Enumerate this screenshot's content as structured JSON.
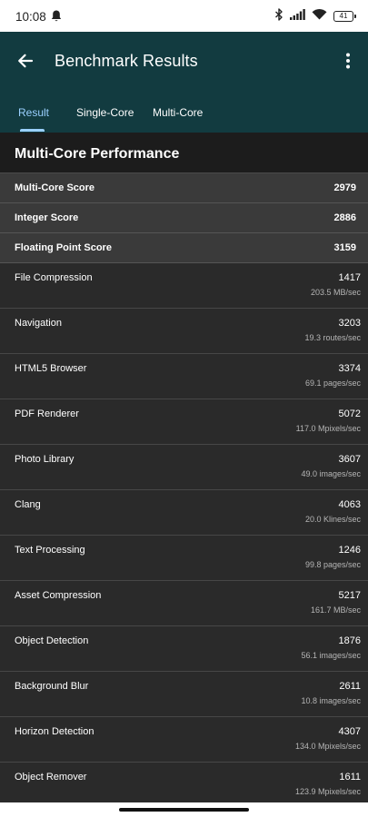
{
  "status_bar": {
    "time": "10:08",
    "battery": "41",
    "icons": [
      "notification-bell-icon",
      "bluetooth-icon",
      "signal-icon",
      "wifi-icon",
      "battery-icon"
    ]
  },
  "header": {
    "title": "Benchmark Results",
    "background": "#123b40",
    "accent": "#9ad0ff"
  },
  "tabs": [
    {
      "label": "Result",
      "active": true
    },
    {
      "label": "Single-Core",
      "active": false
    },
    {
      "label": "Multi-Core",
      "active": false
    }
  ],
  "section": {
    "title": "Multi-Core Performance"
  },
  "summary_scores": [
    {
      "label": "Multi-Core Score",
      "value": "2979"
    },
    {
      "label": "Integer Score",
      "value": "2886"
    },
    {
      "label": "Floating Point Score",
      "value": "3159"
    }
  ],
  "workloads": [
    {
      "name": "File Compression",
      "score": "1417",
      "rate": "203.5 MB/sec"
    },
    {
      "name": "Navigation",
      "score": "3203",
      "rate": "19.3 routes/sec"
    },
    {
      "name": "HTML5 Browser",
      "score": "3374",
      "rate": "69.1 pages/sec"
    },
    {
      "name": "PDF Renderer",
      "score": "5072",
      "rate": "117.0 Mpixels/sec"
    },
    {
      "name": "Photo Library",
      "score": "3607",
      "rate": "49.0 images/sec"
    },
    {
      "name": "Clang",
      "score": "4063",
      "rate": "20.0 Klines/sec"
    },
    {
      "name": "Text Processing",
      "score": "1246",
      "rate": "99.8 pages/sec"
    },
    {
      "name": "Asset Compression",
      "score": "5217",
      "rate": "161.7 MB/sec"
    },
    {
      "name": "Object Detection",
      "score": "1876",
      "rate": "56.1 images/sec"
    },
    {
      "name": "Background Blur",
      "score": "2611",
      "rate": "10.8 images/sec"
    },
    {
      "name": "Horizon Detection",
      "score": "4307",
      "rate": "134.0 Mpixels/sec"
    },
    {
      "name": "Object Remover",
      "score": "1611",
      "rate": "123.9 Mpixels/sec"
    }
  ]
}
